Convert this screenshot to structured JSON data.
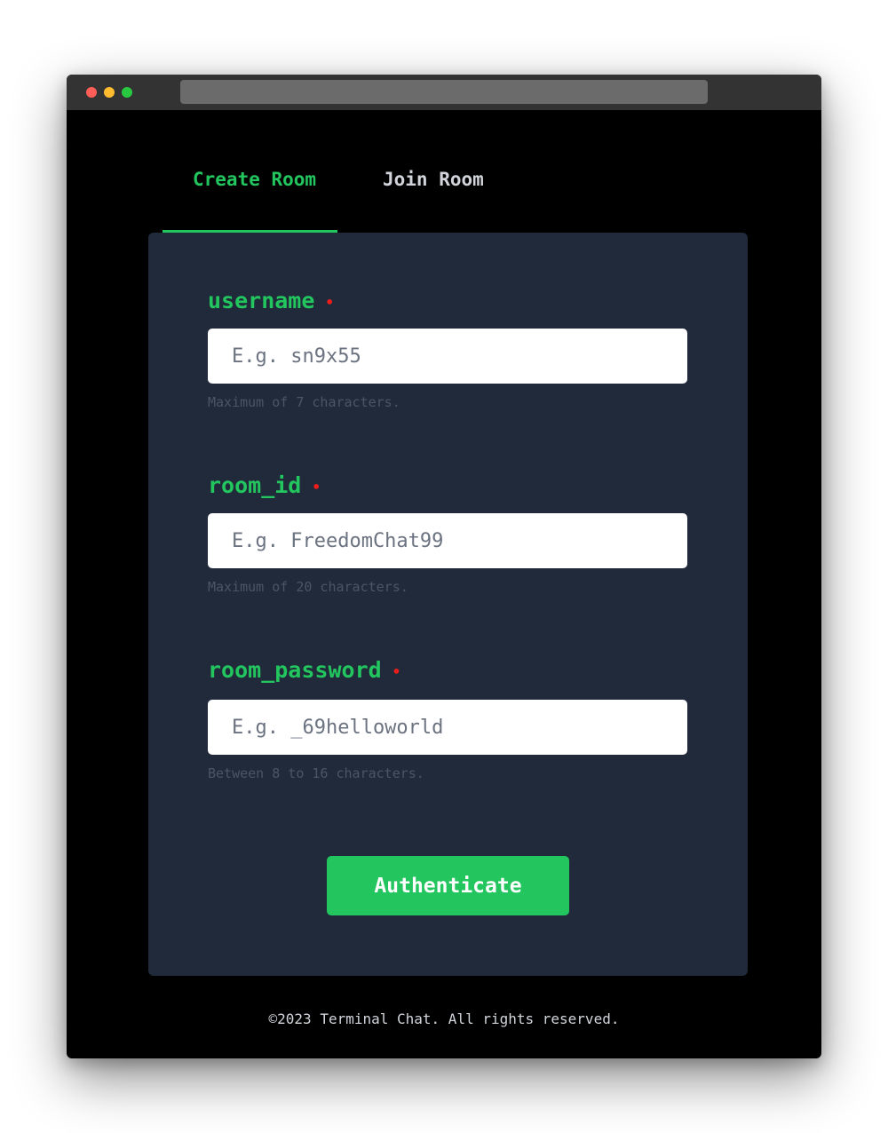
{
  "tabs": {
    "create_label": "Create Room",
    "join_label": "Join Room",
    "active": "Create Room"
  },
  "form": {
    "username": {
      "label": "username",
      "required_mark": "•",
      "placeholder": "E.g. sn9x55",
      "value": "",
      "hint": "Maximum of 7 characters."
    },
    "room_id": {
      "label": "room_id",
      "required_mark": "•",
      "placeholder": "E.g. FreedomChat99",
      "value": "",
      "hint": "Maximum of 20 characters."
    },
    "room_password": {
      "label": "room_password",
      "required_mark": "•",
      "placeholder": "E.g. _69helloworld",
      "value": "",
      "hint": "Between 8 to 16 characters."
    },
    "submit_label": "Authenticate"
  },
  "footer": {
    "text": "©2023 Terminal Chat. All rights reserved."
  },
  "colors": {
    "accent": "#22c55e",
    "background": "#000000",
    "card": "#212a3a",
    "required": "#ef1c1c"
  }
}
